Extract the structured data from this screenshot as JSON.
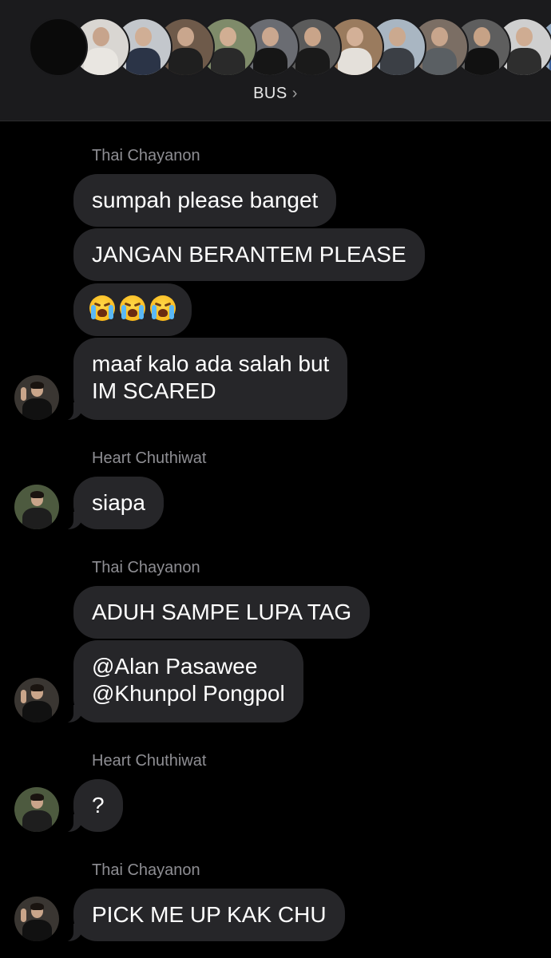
{
  "header": {
    "group_name": "BUS",
    "chevron": "›",
    "member_avatars": [
      {
        "name": "group-placeholder-avatar",
        "bg": "#0a0a0a",
        "head": "#0a0a0a",
        "body": "#0a0a0a"
      },
      {
        "name": "member-avatar-1",
        "bg": "#d9d6d2",
        "head": "#c7a48c",
        "body": "#e9e6e1"
      },
      {
        "name": "member-avatar-2",
        "bg": "#c3c7cc",
        "head": "#d0ae95",
        "body": "#2b3447"
      },
      {
        "name": "member-avatar-3",
        "bg": "#6e5a4a",
        "head": "#c9a68d",
        "body": "#1f1f1f"
      },
      {
        "name": "member-avatar-4",
        "bg": "#7f8b6a",
        "head": "#d1ae93",
        "body": "#2a2a2a"
      },
      {
        "name": "member-avatar-5",
        "bg": "#6a6c72",
        "head": "#caa78f",
        "body": "#161616"
      },
      {
        "name": "member-avatar-6",
        "bg": "#5b5b5b",
        "head": "#c9a489",
        "body": "#1a1a1a"
      },
      {
        "name": "member-avatar-7",
        "bg": "#9a7b5e",
        "head": "#d3b097",
        "body": "#e4e0da"
      },
      {
        "name": "member-avatar-8",
        "bg": "#a9b6c2",
        "head": "#cba98f",
        "body": "#3b3f45"
      },
      {
        "name": "member-avatar-9",
        "bg": "#7b6e64",
        "head": "#c8a58c",
        "body": "#5a5f63"
      },
      {
        "name": "member-avatar-10",
        "bg": "#5e5e5e",
        "head": "#c6a286",
        "body": "#111111"
      },
      {
        "name": "member-avatar-11",
        "bg": "#cfcfcf",
        "head": "#cfac92",
        "body": "#2e2e2e"
      },
      {
        "name": "member-avatar-12",
        "bg": "#8fa6be",
        "head": "#d0ad94",
        "body": "#3a5f9a"
      }
    ]
  },
  "messages": {
    "sender_thai_1": "Thai Chayanon",
    "m1": "sumpah please banget",
    "m2": "JANGAN BERANTEM PLEASE",
    "m3_emoji": [
      "crying-face",
      "crying-face",
      "crying-face"
    ],
    "m4_line1": "maaf kalo ada salah but",
    "m4_line2": "IM SCARED",
    "sender_heart_1": "Heart Chuthiwat",
    "m5": "siapa",
    "sender_thai_2": "Thai Chayanon",
    "m6": "ADUH SAMPE LUPA TAG",
    "m7_line1": "@Alan Pasawee",
    "m7_line2": "@Khunpol Pongpol",
    "sender_heart_2": "Heart Chuthiwat",
    "m8": "?",
    "sender_thai_3": "Thai Chayanon",
    "m9": "PICK ME UP KAK CHU"
  },
  "colors": {
    "background": "#000000",
    "header": "#1b1b1d",
    "bubble": "#262629",
    "sender_label": "#8e8e93"
  }
}
